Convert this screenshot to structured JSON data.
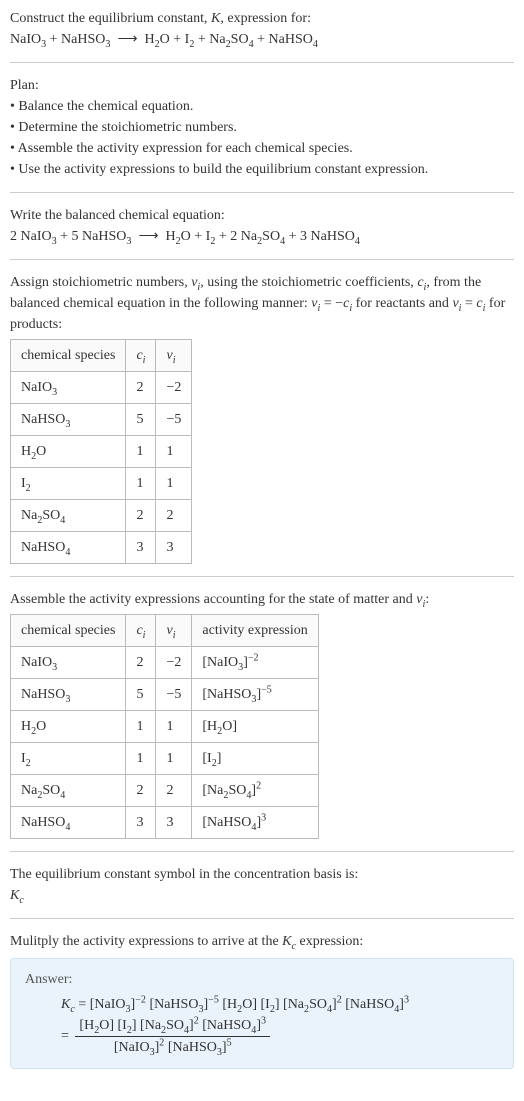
{
  "header": {
    "title_html": "Construct the equilibrium constant, <span class='math'>K</span>, expression for:",
    "eq_html": "NaIO<sub>3</sub> + NaHSO<sub>3</sub>&nbsp; ⟶ &nbsp;H<sub>2</sub>O + I<sub>2</sub> + Na<sub>2</sub>SO<sub>4</sub> + NaHSO<sub>4</sub>"
  },
  "plan": {
    "label": "Plan:",
    "items": [
      "• Balance the chemical equation.",
      "• Determine the stoichiometric numbers.",
      "• Assemble the activity expression for each chemical species.",
      "• Use the activity expressions to build the equilibrium constant expression."
    ]
  },
  "balanced": {
    "label": "Write the balanced chemical equation:",
    "eq_html": "2 NaIO<sub>3</sub> + 5 NaHSO<sub>3</sub>&nbsp; ⟶ &nbsp;H<sub>2</sub>O + I<sub>2</sub> + 2 Na<sub>2</sub>SO<sub>4</sub> + 3 NaHSO<sub>4</sub>"
  },
  "stoich": {
    "intro_html": "Assign stoichiometric numbers, <span class='math'>ν<sub>i</sub></span>, using the stoichiometric coefficients, <span class='math'>c<sub>i</sub></span>, from the balanced chemical equation in the following manner: <span class='math'>ν<sub>i</sub></span> = −<span class='math'>c<sub>i</sub></span> for reactants and <span class='math'>ν<sub>i</sub></span> = <span class='math'>c<sub>i</sub></span> for products:",
    "headers": {
      "species": "chemical species",
      "ci_html": "<span class='math'>c<sub>i</sub></span>",
      "vi_html": "<span class='math'>ν<sub>i</sub></span>"
    },
    "rows": [
      {
        "species_html": "NaIO<sub>3</sub>",
        "ci": "2",
        "vi": "−2"
      },
      {
        "species_html": "NaHSO<sub>3</sub>",
        "ci": "5",
        "vi": "−5"
      },
      {
        "species_html": "H<sub>2</sub>O",
        "ci": "1",
        "vi": "1"
      },
      {
        "species_html": "I<sub>2</sub>",
        "ci": "1",
        "vi": "1"
      },
      {
        "species_html": "Na<sub>2</sub>SO<sub>4</sub>",
        "ci": "2",
        "vi": "2"
      },
      {
        "species_html": "NaHSO<sub>4</sub>",
        "ci": "3",
        "vi": "3"
      }
    ]
  },
  "activity": {
    "intro_html": "Assemble the activity expressions accounting for the state of matter and <span class='math'>ν<sub>i</sub></span>:",
    "headers": {
      "species": "chemical species",
      "ci_html": "<span class='math'>c<sub>i</sub></span>",
      "vi_html": "<span class='math'>ν<sub>i</sub></span>",
      "act": "activity expression"
    },
    "rows": [
      {
        "species_html": "NaIO<sub>3</sub>",
        "ci": "2",
        "vi": "−2",
        "act_html": "[NaIO<sub>3</sub>]<sup>−2</sup>"
      },
      {
        "species_html": "NaHSO<sub>3</sub>",
        "ci": "5",
        "vi": "−5",
        "act_html": "[NaHSO<sub>3</sub>]<sup>−5</sup>"
      },
      {
        "species_html": "H<sub>2</sub>O",
        "ci": "1",
        "vi": "1",
        "act_html": "[H<sub>2</sub>O]"
      },
      {
        "species_html": "I<sub>2</sub>",
        "ci": "1",
        "vi": "1",
        "act_html": "[I<sub>2</sub>]"
      },
      {
        "species_html": "Na<sub>2</sub>SO<sub>4</sub>",
        "ci": "2",
        "vi": "2",
        "act_html": "[Na<sub>2</sub>SO<sub>4</sub>]<sup>2</sup>"
      },
      {
        "species_html": "NaHSO<sub>4</sub>",
        "ci": "3",
        "vi": "3",
        "act_html": "[NaHSO<sub>4</sub>]<sup>3</sup>"
      }
    ]
  },
  "symbol": {
    "label": "The equilibrium constant symbol in the concentration basis is:",
    "value_html": "<span class='math'>K<sub>c</sub></span>"
  },
  "multiply": {
    "label_html": "Mulitply the activity expressions to arrive at the <span class='math'>K<sub>c</sub></span> expression:"
  },
  "answer": {
    "label": "Answer:",
    "line1_html": "<span class='math'>K<sub>c</sub></span> = [NaIO<sub>3</sub>]<sup>−2</sup> [NaHSO<sub>3</sub>]<sup>−5</sup> [H<sub>2</sub>O] [I<sub>2</sub>] [Na<sub>2</sub>SO<sub>4</sub>]<sup>2</sup> [NaHSO<sub>4</sub>]<sup>3</sup>",
    "eq_sign": "=",
    "frac_num_html": "[H<sub>2</sub>O] [I<sub>2</sub>] [Na<sub>2</sub>SO<sub>4</sub>]<sup>2</sup> [NaHSO<sub>4</sub>]<sup>3</sup>",
    "frac_den_html": "[NaIO<sub>3</sub>]<sup>2</sup> [NaHSO<sub>3</sub>]<sup>5</sup>"
  }
}
